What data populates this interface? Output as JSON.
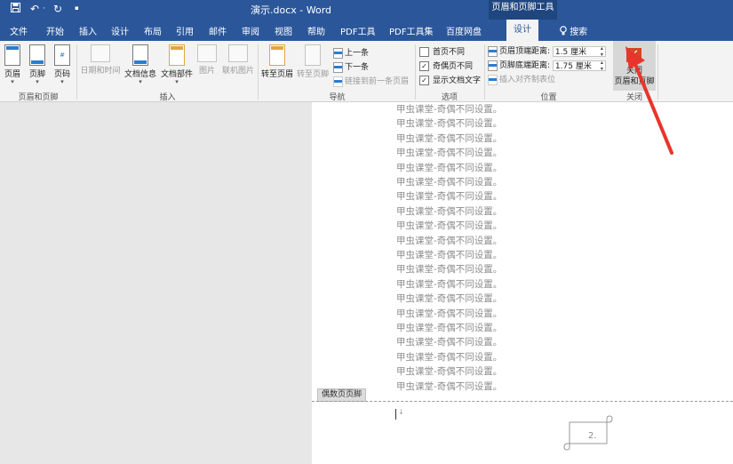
{
  "title_bar": {
    "doc_title": "演示.docx  -  Word",
    "context_title": "页眉和页脚工具",
    "undo_glyph": "↶",
    "redo_glyph": "↻",
    "qa_sep": "·",
    "qa_dot": "▪"
  },
  "tabs": {
    "file": "文件",
    "home": "开始",
    "insert": "插入",
    "design_main": "设计",
    "layout": "布局",
    "references": "引用",
    "mailings": "邮件",
    "review": "审阅",
    "view": "视图",
    "help": "帮助",
    "pdf_tools": "PDF工具",
    "pdf_tools_set": "PDF工具集",
    "baidu_pan": "百度网盘",
    "design_active": "设计",
    "search": "搜索"
  },
  "ribbon": {
    "header_footer": {
      "header": "页眉",
      "footer": "页脚",
      "page_number": "页码",
      "group_label": "页眉和页脚"
    },
    "insert": {
      "date_time": "日期和时间",
      "doc_info": "文档信息",
      "doc_parts": "文档部件",
      "pictures": "图片",
      "online_pictures": "联机图片",
      "group_label": "插入"
    },
    "navigation": {
      "goto_header": "转至页眉",
      "goto_footer": "转至页脚",
      "previous": "上一条",
      "next": "下一条",
      "link_previous": "链接到前一条页眉",
      "group_label": "导航"
    },
    "options": {
      "first_page_different": "首页不同",
      "odd_even_different": "奇偶页不同",
      "show_doc_text": "显示文档文字",
      "first_page_checked": false,
      "odd_even_checked": true,
      "show_doc_text_checked": true,
      "check_mark": "✓",
      "group_label": "选项"
    },
    "position": {
      "header_top_label": "页眉顶端距离:",
      "header_top_value": "1.5 厘米",
      "footer_bottom_label": "页脚底端距离:",
      "footer_bottom_value": "1.75 厘米",
      "insert_align_tab": "插入对齐制表位",
      "group_label": "位置"
    },
    "close": {
      "close_button_label": "关闭\n页眉和页脚",
      "group_label": "关闭",
      "close_glyph": "✕"
    }
  },
  "document": {
    "body_lines": [
      "甲虫课堂-奇偶不同设置。",
      "甲虫课堂-奇偶不同设置。",
      "甲虫课堂-奇偶不同设置。",
      "甲虫课堂-奇偶不同设置。",
      "甲虫课堂-奇偶不同设置。",
      "甲虫课堂-奇偶不同设置。",
      "甲虫课堂-奇偶不同设置。",
      "甲虫课堂-奇偶不同设置。",
      "甲虫课堂-奇偶不同设置。",
      "甲虫课堂-奇偶不同设置。",
      "甲虫课堂-奇偶不同设置。",
      "甲虫课堂-奇偶不同设置。",
      "甲虫课堂-奇偶不同设置。",
      "甲虫课堂-奇偶不同设置。",
      "甲虫课堂-奇偶不同设置。",
      "甲虫课堂-奇偶不同设置。",
      "甲虫课堂-奇偶不同设置。",
      "甲虫课堂-奇偶不同设置。",
      "甲虫课堂-奇偶不同设置。",
      "甲虫课堂-奇偶不同设置。"
    ],
    "footer_tag": "偶数页页脚",
    "footer_paragraph_mark": "↓",
    "page_number": "2.",
    "page_number_shape": "scroll-banner"
  },
  "overlay": {
    "arrow_color": "#e8352b"
  },
  "colors": {
    "title_blue": "#2b579a",
    "close_orange": "#d24726",
    "arrow_red": "#e8352b"
  }
}
